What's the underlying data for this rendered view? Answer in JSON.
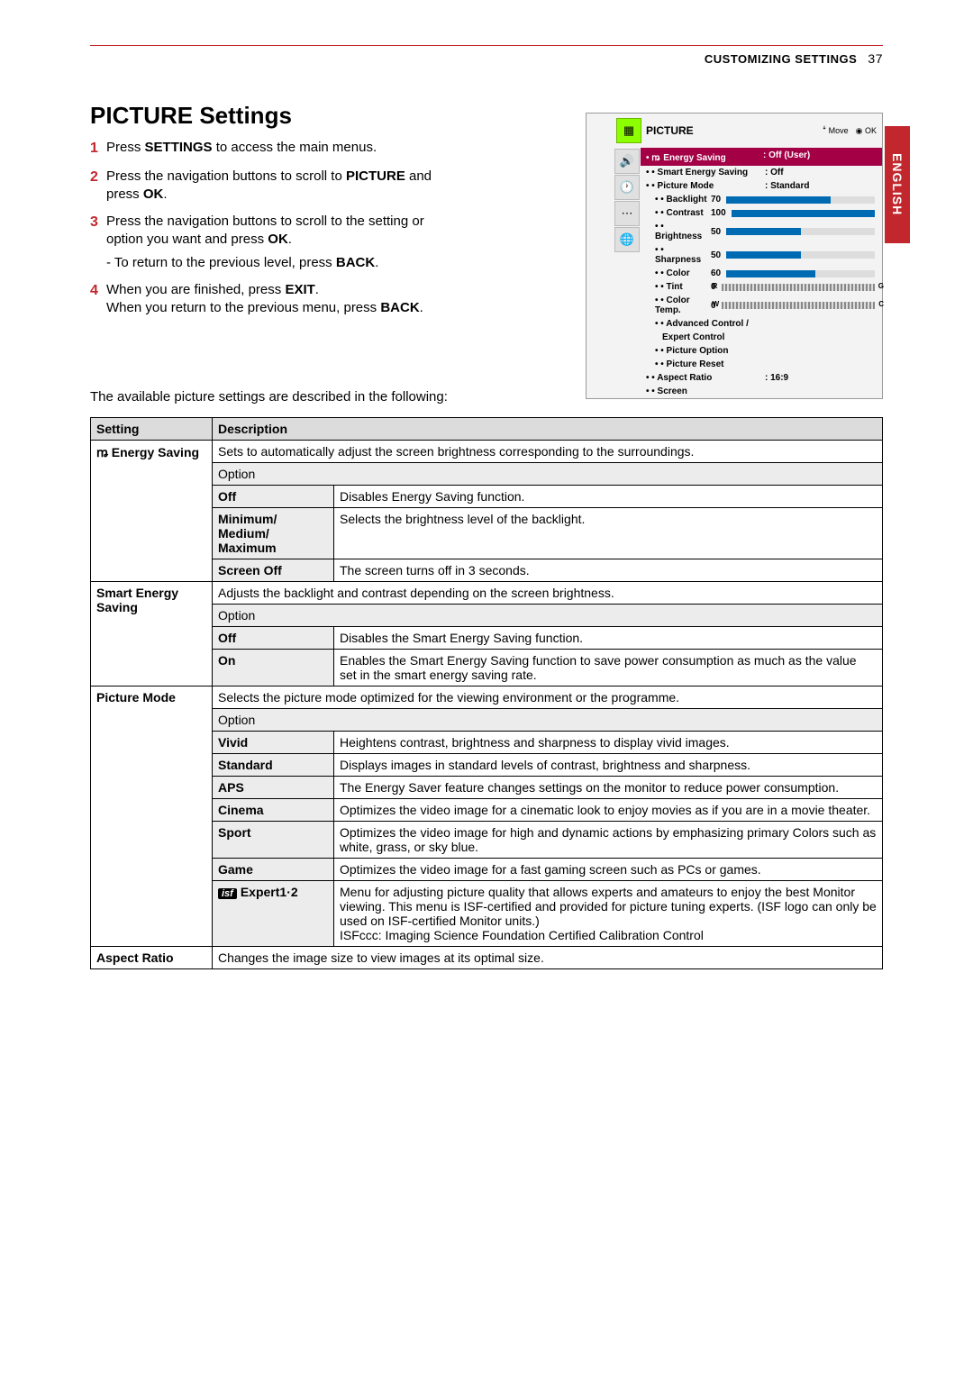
{
  "header": {
    "section": "CUSTOMIZING SETTINGS",
    "page": "37",
    "lang": "ENGLISH"
  },
  "title": "PICTURE Settings",
  "steps": [
    {
      "n": "1",
      "body": "Press <b>SETTINGS</b> to access the main menus."
    },
    {
      "n": "2",
      "body": "Press the navigation buttons to scroll to <b>PICTURE</b> and press <b>OK</b>."
    },
    {
      "n": "3",
      "body": "Press the navigation buttons to scroll to the setting or option you want and press <b>OK</b>.<div class='sub'>- To return to the previous level, press <b>BACK</b>.</div>"
    },
    {
      "n": "4",
      "body": "When you are finished, press <b>EXIT</b>.<br>When you return to the previous menu, press <b>BACK</b>."
    }
  ],
  "intro": "The available picture settings are described in the following:",
  "osd": {
    "title": "PICTURE",
    "move": "Move",
    "ok": "OK",
    "energy_label": "Energy Saving",
    "energy_val": "Off (User)",
    "rows": {
      "ses": {
        "k": "Smart Energy Saving",
        "v": ": Off"
      },
      "pm": {
        "k": "Picture Mode",
        "v": ": Standard"
      },
      "backlight": {
        "k": "Backlight",
        "n": "70",
        "pct": 70
      },
      "contrast": {
        "k": "Contrast",
        "n": "100",
        "pct": 100
      },
      "brightness": {
        "k": "Brightness",
        "n": "50",
        "pct": 50
      },
      "sharpness": {
        "k": "Sharpness",
        "n": "50",
        "pct": 50
      },
      "color": {
        "k": "Color",
        "n": "60",
        "pct": 60
      },
      "tint": {
        "k": "Tint",
        "n": "0"
      },
      "ct": {
        "k": "Color Temp.",
        "n": "0"
      },
      "adv": {
        "k": "Advanced Control /"
      },
      "adv2": {
        "k": "Expert Control"
      },
      "po": {
        "k": "Picture Option"
      },
      "pr": {
        "k": "Picture Reset"
      },
      "ar": {
        "k": "Aspect Ratio",
        "v": ": 16:9"
      },
      "sc": {
        "k": "Screen"
      }
    }
  },
  "table": {
    "th1": "Setting",
    "th2": "Description",
    "option": "Option",
    "r1": {
      "s": "ꬺ Energy Saving",
      "d": "Sets to automatically adjust the screen brightness corresponding to the surroundings.",
      "o1": {
        "k": "Off",
        "v": "Disables Energy Saving function."
      },
      "o2": {
        "k": "Minimum/ Medium/ Maximum",
        "v": "Selects the brightness level of the backlight."
      },
      "o3": {
        "k": "Screen Off",
        "v": "The screen turns off in 3 seconds."
      }
    },
    "r2": {
      "s": "Smart Energy Saving",
      "d": "Adjusts the backlight and contrast depending on the screen brightness.",
      "o1": {
        "k": "Off",
        "v": "Disables the Smart Energy Saving function."
      },
      "o2": {
        "k": "On",
        "v": "Enables the Smart Energy Saving function to save power consumption as much as the value set in the smart energy saving rate."
      }
    },
    "r3": {
      "s": "Picture Mode",
      "d": "Selects the picture mode optimized for the viewing environment or the programme.",
      "o1": {
        "k": "Vivid",
        "v": "Heightens contrast, brightness and sharpness to display vivid images."
      },
      "o2": {
        "k": "Standard",
        "v": "Displays images in standard levels of contrast, brightness and sharpness."
      },
      "o3": {
        "k": "APS",
        "v": "The Energy Saver feature changes settings on the monitor to reduce power consumption."
      },
      "o4": {
        "k": "Cinema",
        "v": "Optimizes the video image for a cinematic look to enjoy movies as if you are in a movie theater."
      },
      "o5": {
        "k": "Sport",
        "v": "Optimizes the video image for high and dynamic actions by emphasizing primary Colors such as white, grass, or sky blue."
      },
      "o6": {
        "k": "Game",
        "v": "Optimizes the video image for a fast gaming screen such as PCs or games."
      },
      "o7": {
        "k": "Expert1·2",
        "v": "Menu for adjusting picture quality that allows experts and amateurs to enjoy the best Monitor viewing. This menu is ISF-certified and provided for picture tuning experts. (ISF logo can only be used on ISF-certified Monitor units.)<br>ISFccc: Imaging Science Foundation Certified Calibration Control"
      }
    },
    "r4": {
      "s": "Aspect Ratio",
      "d": "Changes the image size to view images at its optimal size."
    }
  }
}
